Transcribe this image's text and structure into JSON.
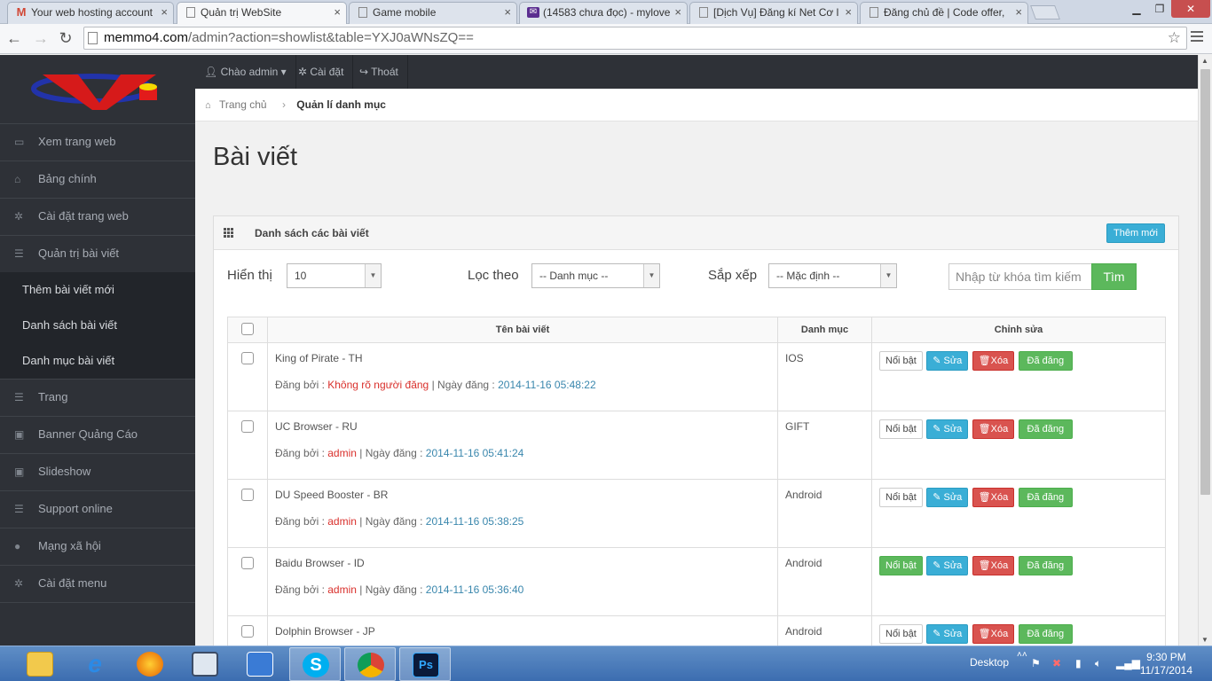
{
  "browser": {
    "tabs": [
      {
        "title": "Your web hosting account",
        "icon": "gmail-icon",
        "active": false
      },
      {
        "title": "Quản trị WebSite",
        "icon": "page-icon",
        "active": true
      },
      {
        "title": "Game mobile",
        "icon": "page-icon",
        "active": false
      },
      {
        "title": "(14583 chưa đọc) - mylove",
        "icon": "yahoo-mail-icon",
        "active": false
      },
      {
        "title": "[Dịch Vụ] Đăng kí Net Cơ l",
        "icon": "page-icon",
        "active": false
      },
      {
        "title": "Đăng chủ đề | Code offer,",
        "icon": "page-icon",
        "active": false
      }
    ],
    "url_host": "memmo4.com",
    "url_path": "/admin?action=showlist&table=YXJ0aWNsZQ=="
  },
  "topbar": {
    "user_label": "Chào admin",
    "settings_label": "Cài đặt",
    "logout_label": "Thoát"
  },
  "breadcrumb": {
    "home": "Trang chủ",
    "current": "Quản lí danh mục"
  },
  "sidebar": {
    "items": [
      {
        "label": "Xem trang web",
        "icon": "monitor-icon"
      },
      {
        "label": "Bảng chính",
        "icon": "home-icon"
      },
      {
        "label": "Cài đặt trang web",
        "icon": "gear-icon"
      },
      {
        "label": "Quản trị bài viết",
        "icon": "list-icon"
      }
    ],
    "subitems": [
      {
        "label": "Thêm bài viết mới"
      },
      {
        "label": "Danh sách bài viết"
      },
      {
        "label": "Danh mục bài viết"
      }
    ],
    "items2": [
      {
        "label": "Trang",
        "icon": "list-icon"
      },
      {
        "label": "Banner Quảng Cáo",
        "icon": "image-icon"
      },
      {
        "label": "Slideshow",
        "icon": "image-icon"
      },
      {
        "label": "Support online",
        "icon": "list-icon"
      },
      {
        "label": "Mạng xã hội",
        "icon": "globe-icon"
      },
      {
        "label": "Cài đặt menu",
        "icon": "gear-icon"
      }
    ]
  },
  "main": {
    "title": "Bài viết",
    "panel_title": "Danh sách các bài viết",
    "add_button": "Thêm mới",
    "filters": {
      "show_label": "Hiển thị",
      "show_value": "10",
      "filter_label": "Lọc theo",
      "filter_value": "-- Danh mục --",
      "sort_label": "Sắp xếp",
      "sort_value": "-- Mặc định --",
      "search_placeholder": "Nhập từ khóa tìm kiếm",
      "search_button": "Tìm"
    },
    "table": {
      "headers": [
        "Tên bài viết",
        "Danh mục",
        "Chỉnh sửa"
      ],
      "posted_by_label": "Đăng bởi :",
      "date_label": "Ngày đăng :",
      "btn_feature": "Nổi bật",
      "btn_edit": "Sửa",
      "btn_delete": "Xóa",
      "btn_published": "Đã đăng",
      "rows": [
        {
          "name": "King of Pirate - TH",
          "author": "Không rõ người đăng",
          "date": "2014-11-16 05:48:22",
          "category": "IOS",
          "featured": false
        },
        {
          "name": "UC Browser - RU",
          "author": "admin",
          "date": "2014-11-16 05:41:24",
          "category": "GIFT",
          "featured": false
        },
        {
          "name": "DU Speed Booster - BR",
          "author": "admin",
          "date": "2014-11-16 05:38:25",
          "category": "Android",
          "featured": false
        },
        {
          "name": "Baidu Browser - ID",
          "author": "admin",
          "date": "2014-11-16 05:36:40",
          "category": "Android",
          "featured": true
        },
        {
          "name": "Dolphin Browser - JP",
          "author": "",
          "date": "",
          "category": "Android",
          "featured": false
        }
      ]
    }
  },
  "taskbar": {
    "desktop_label": "Desktop",
    "time": "9:30 PM",
    "date": "11/17/2014"
  }
}
